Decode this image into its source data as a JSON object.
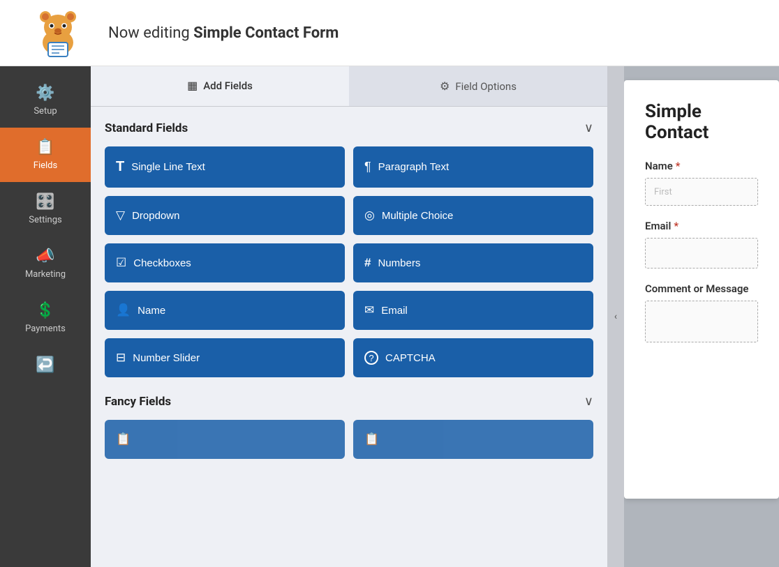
{
  "header": {
    "title_prefix": "Now editing ",
    "title_bold": "Simple Contact Form"
  },
  "sidebar": {
    "items": [
      {
        "id": "setup",
        "label": "Setup",
        "icon": "⚙️",
        "active": false
      },
      {
        "id": "fields",
        "label": "Fields",
        "icon": "📋",
        "active": true
      },
      {
        "id": "settings",
        "label": "Settings",
        "icon": "🎛️",
        "active": false
      },
      {
        "id": "marketing",
        "label": "Marketing",
        "icon": "📣",
        "active": false
      },
      {
        "id": "payments",
        "label": "Payments",
        "icon": "💲",
        "active": false
      },
      {
        "id": "history",
        "label": "",
        "icon": "↩️",
        "active": false
      }
    ]
  },
  "tabs": [
    {
      "id": "add-fields",
      "label": "Add Fields",
      "icon": "📋",
      "active": true
    },
    {
      "id": "field-options",
      "label": "Field Options",
      "icon": "🎛️",
      "active": false
    }
  ],
  "standard_fields": {
    "section_title": "Standard Fields",
    "fields": [
      {
        "id": "single-line-text",
        "label": "Single Line Text",
        "icon": "T"
      },
      {
        "id": "paragraph-text",
        "label": "Paragraph Text",
        "icon": "¶"
      },
      {
        "id": "dropdown",
        "label": "Dropdown",
        "icon": "▽"
      },
      {
        "id": "multiple-choice",
        "label": "Multiple Choice",
        "icon": "◎"
      },
      {
        "id": "checkboxes",
        "label": "Checkboxes",
        "icon": "☑"
      },
      {
        "id": "numbers",
        "label": "Numbers",
        "icon": "#"
      },
      {
        "id": "name",
        "label": "Name",
        "icon": "👤"
      },
      {
        "id": "email",
        "label": "Email",
        "icon": "✉"
      },
      {
        "id": "number-slider",
        "label": "Number Slider",
        "icon": "🎚"
      },
      {
        "id": "captcha",
        "label": "CAPTCHA",
        "icon": "?"
      }
    ]
  },
  "fancy_fields": {
    "section_title": "Fancy Fields"
  },
  "form_preview": {
    "title": "Simple Contact",
    "name_label": "Name",
    "name_placeholder": "First",
    "email_label": "Email",
    "comment_label": "Comment or Message"
  },
  "collapse_icon": "‹"
}
